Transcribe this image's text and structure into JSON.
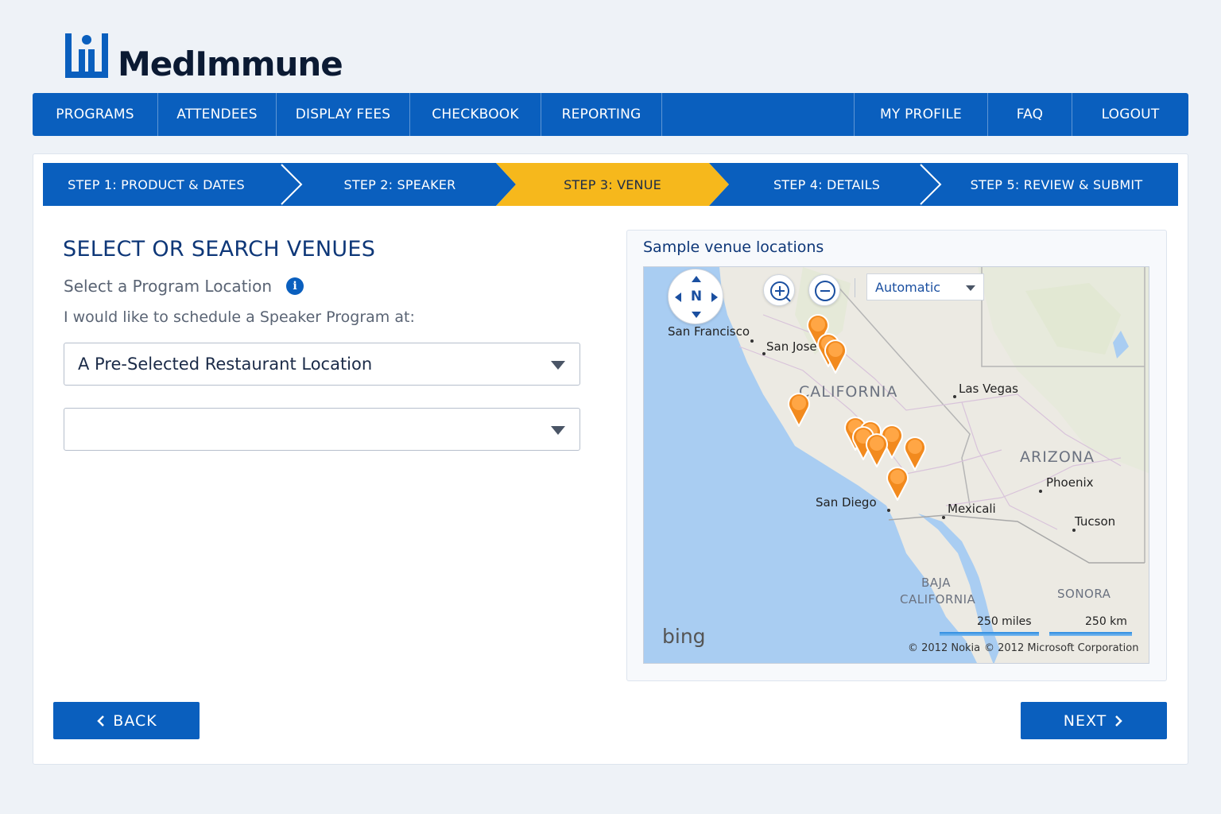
{
  "brand": {
    "name": "MedImmune",
    "color": "#0a5fbe"
  },
  "nav": {
    "left": [
      "PROGRAMS",
      "ATTENDEES",
      "DISPLAY FEES",
      "CHECKBOOK",
      "REPORTING"
    ],
    "right": [
      "MY PROFILE",
      "FAQ",
      "LOGOUT"
    ]
  },
  "steps": [
    {
      "label": "STEP 1: PRODUCT & DATES",
      "active": false
    },
    {
      "label": "STEP 2: SPEAKER",
      "active": false
    },
    {
      "label": "STEP 3: VENUE",
      "active": true
    },
    {
      "label": "STEP 4: DETAILS",
      "active": false
    },
    {
      "label": "STEP 5: REVIEW & SUBMIT",
      "active": false
    }
  ],
  "venue": {
    "heading": "SELECT OR SEARCH VENUES",
    "location_label": "Select a Program Location",
    "info_icon": "info-icon",
    "schedule_label": "I would like to schedule a Speaker Program at:",
    "select1_value": "A Pre-Selected Restaurant Location",
    "select2_value": ""
  },
  "map": {
    "title": "Sample venue locations",
    "compass_label": "N",
    "map_type": "Automatic",
    "cities": [
      "San Francisco",
      "San Jose",
      "Las Vegas",
      "Phoenix",
      "San Diego",
      "Mexicali",
      "Tucson"
    ],
    "regions": {
      "california": "CALIFORNIA",
      "arizona": "ARIZONA",
      "baja_1": "BAJA",
      "baja_2": "CALIFORNIA",
      "sonora": "SONORA"
    },
    "provider": "bing",
    "scale_miles": "250 miles",
    "scale_km": "250 km",
    "copyright_nokia": "© 2012 Nokia",
    "copyright_ms": "© 2012 Microsoft Corporation",
    "pin_color": "#f28a1e"
  },
  "buttons": {
    "back": "BACK",
    "next": "NEXT"
  },
  "colors": {
    "primary": "#0a5fbe",
    "active_step": "#f6b81c",
    "heading": "#0e3778"
  }
}
